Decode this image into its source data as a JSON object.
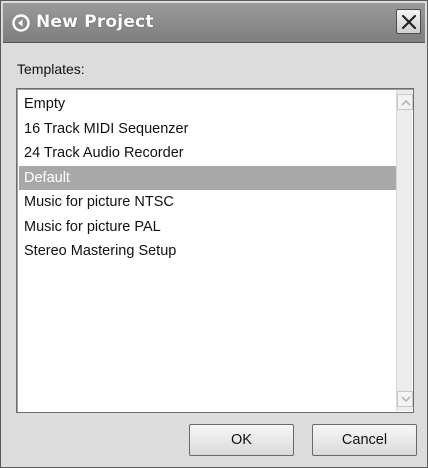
{
  "window": {
    "title": "New Project",
    "app_icon": "cubase-logo-icon",
    "close_icon": "close-x-icon"
  },
  "templates": {
    "label": "Templates:",
    "items": [
      {
        "label": "Empty",
        "selected": false
      },
      {
        "label": "16 Track MIDI Sequenzer",
        "selected": false
      },
      {
        "label": "24 Track Audio Recorder",
        "selected": false
      },
      {
        "label": "Default",
        "selected": true
      },
      {
        "label": "Music for picture NTSC",
        "selected": false
      },
      {
        "label": "Music for picture PAL",
        "selected": false
      },
      {
        "label": "Stereo Mastering Setup",
        "selected": false
      }
    ]
  },
  "buttons": {
    "ok_label": "OK",
    "cancel_label": "Cancel"
  },
  "colors": {
    "titlebar": "#8a8a8a",
    "selection": "#a8a8a8",
    "dialog_bg": "#dcdcdc"
  }
}
